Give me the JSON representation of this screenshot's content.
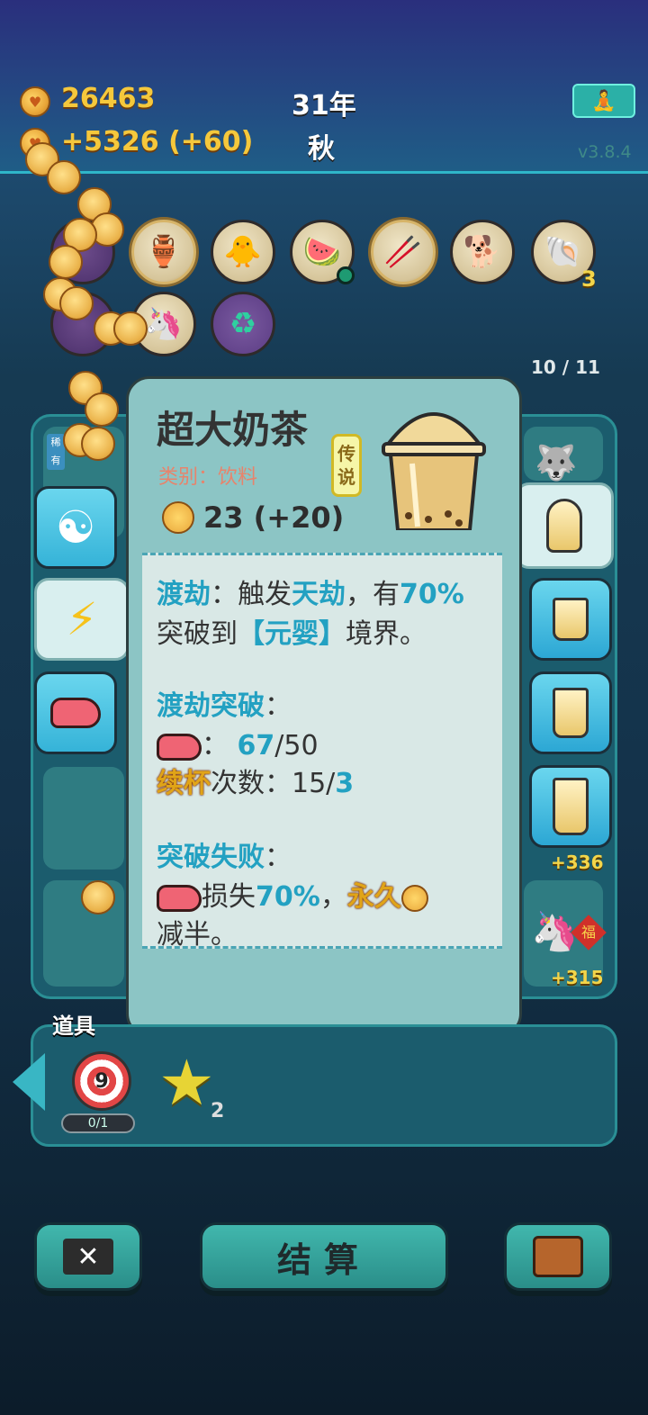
{
  "header": {
    "gold": "26463",
    "income": "+5326 (+60)",
    "year": "31年",
    "season": "秋",
    "version": "v3.8.4"
  },
  "relics": {
    "shell_count": "3"
  },
  "page_counter": "10 / 11",
  "card": {
    "title": "超大奶茶",
    "category": "类别：饮料",
    "rarity": "传说",
    "value": "23 (+20)"
  },
  "desc": {
    "l1_a": "渡劫",
    "l1_b": "：触发",
    "l1_c": "天劫",
    "l1_d": "，有",
    "l1_e": "70%",
    "l2_a": "突破到",
    "l2_b": "【元婴】",
    "l2_c": "境界。",
    "l3": "渡劫突破",
    "l3_colon": "：",
    "l4_colon": "：",
    "l4_a": "67",
    "l4_b": "/50",
    "l5_a": "续杯",
    "l5_b": "次数：15/",
    "l5_c": "3",
    "l6": "突破失败",
    "l6_colon": "：",
    "l7_a": "损失",
    "l7_b": "70%",
    "l7_c": "，",
    "l7_d": "永久",
    "l8": "减半。"
  },
  "grid": {
    "slot_rare_tag": "稀有",
    "score_a": "+336",
    "score_b": "+315",
    "stamp": "福"
  },
  "items": {
    "label": "道具",
    "target_num": "9",
    "target_count": "0/1",
    "star_count": "2"
  },
  "bottom": {
    "settle": "结算"
  },
  "colors": {
    "accent": "#23a1c2",
    "gold": "#f5c83c",
    "card_bg": "#8cc5c5"
  }
}
